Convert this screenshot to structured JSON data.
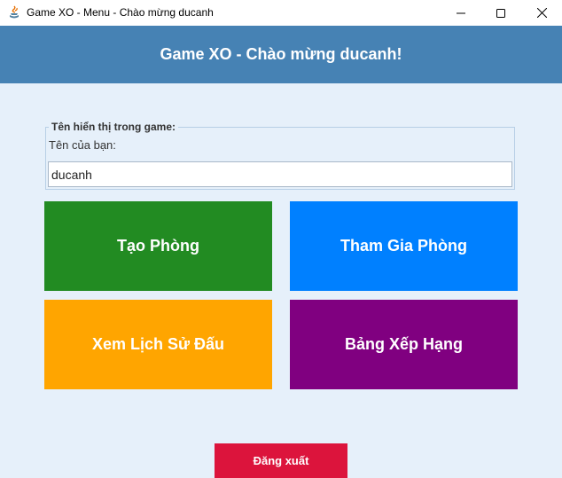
{
  "window": {
    "title": "Game XO - Menu - Chào mừng ducanh",
    "app_icon": "java-icon"
  },
  "header": {
    "title": "Game XO - Chào mừng ducanh!"
  },
  "name_panel": {
    "legend": "Tên hiển thị trong game:",
    "label": "Tên của bạn:",
    "value": "ducanh"
  },
  "buttons": {
    "create_room": {
      "label": "Tạo Phòng",
      "color": "#228b22"
    },
    "join_room": {
      "label": "Tham Gia Phòng",
      "color": "#0080ff"
    },
    "history": {
      "label": "Xem Lịch Sử Đấu",
      "color": "#ffa500"
    },
    "leaderboard": {
      "label": "Bảng Xếp Hạng",
      "color": "#800080"
    },
    "logout": {
      "label": "Đăng xuất",
      "color": "#dc143c"
    }
  },
  "colors": {
    "header_bg": "#4682b4",
    "content_bg": "#e6f0fa"
  }
}
